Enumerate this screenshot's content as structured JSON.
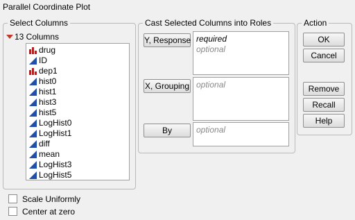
{
  "window_title": "Parallel Coordinate Plot",
  "select_columns": {
    "title": "Select Columns",
    "count_label": "13 Columns",
    "columns": [
      {
        "name": "drug",
        "type": "nominal"
      },
      {
        "name": "ID",
        "type": "continuous"
      },
      {
        "name": "dep1",
        "type": "nominal"
      },
      {
        "name": "hist0",
        "type": "continuous"
      },
      {
        "name": "hist1",
        "type": "continuous"
      },
      {
        "name": "hist3",
        "type": "continuous"
      },
      {
        "name": "hist5",
        "type": "continuous"
      },
      {
        "name": "LogHist0",
        "type": "continuous"
      },
      {
        "name": "LogHist1",
        "type": "continuous"
      },
      {
        "name": "diff",
        "type": "continuous"
      },
      {
        "name": "mean",
        "type": "continuous"
      },
      {
        "name": "LogHist3",
        "type": "continuous"
      },
      {
        "name": "LogHist5",
        "type": "continuous"
      }
    ]
  },
  "cast": {
    "title": "Cast Selected Columns into Roles",
    "roles": [
      {
        "button": "Y, Response",
        "required": "required",
        "optional": "optional"
      },
      {
        "button": "X, Grouping",
        "optional": "optional"
      },
      {
        "button": "By",
        "optional": "optional"
      }
    ]
  },
  "action": {
    "title": "Action",
    "ok": "OK",
    "cancel": "Cancel",
    "remove": "Remove",
    "recall": "Recall",
    "help": "Help"
  },
  "options": {
    "scale_uniformly": "Scale Uniformly",
    "center_at_zero": "Center at zero"
  },
  "colors": {
    "nominal_icon": "#b22222",
    "continuous_icon": "#1f4fa8",
    "disclosure": "#c0392b"
  }
}
